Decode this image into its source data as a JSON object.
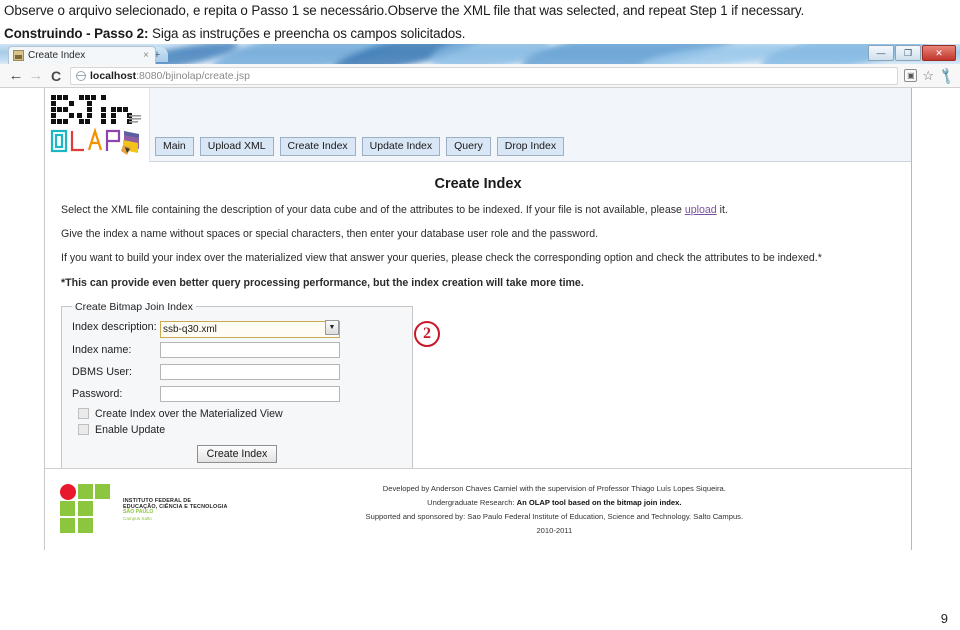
{
  "slide": {
    "caption_line1": "Observe o arquivo selecionado, e repita o Passo 1 se necessário.Observe the XML file that was selected, and repeat Step 1 if necessary.",
    "caption_line2_bold": "Construindo - Passo 2:",
    "caption_line2_rest": " Siga as instruções e preencha os campos solicitados.",
    "page_number": "9"
  },
  "browser": {
    "tab_title": "Create Index",
    "tab_close": "×",
    "new_tab": "+",
    "back_icon": "←",
    "forward_icon": "→",
    "reload_icon": "C",
    "url_host": "localhost",
    "url_rest": ":8080/bjinolap/create.jsp",
    "window_minimize": "—",
    "window_maximize": "❐",
    "window_close": "✕",
    "toolbar_icons": [
      "page-icon",
      "bookmark-star-icon",
      "wrench-menu-icon"
    ]
  },
  "site": {
    "logo_alt": "BJIn OLAP",
    "logo_word_top": "BJIn",
    "logo_word_bottom": "OLAP",
    "nav": [
      {
        "label": "Main"
      },
      {
        "label": "Upload XML"
      },
      {
        "label": "Create Index"
      },
      {
        "label": "Update Index"
      },
      {
        "label": "Query"
      },
      {
        "label": "Drop Index"
      }
    ],
    "page_title": "Create Index",
    "paragraphs": [
      {
        "text_before": "Select the XML file containing the description of your data cube and of the attributes to be indexed. If your file is not available, please ",
        "link": "upload",
        "text_after": " it.",
        "bold": false
      },
      {
        "text_before": "Give the index a name without spaces or special characters, then enter your database user role and the password.",
        "link": "",
        "text_after": "",
        "bold": false
      },
      {
        "text_before": "If you want to build your index over the materialized view that answer your queries, please check the corresponding option and check the attributes to be indexed.*",
        "link": "",
        "text_after": "",
        "bold": false
      },
      {
        "text_before": "*This can provide even better query processing performance, but the index creation will take more time.",
        "link": "",
        "text_after": "",
        "bold": true
      }
    ],
    "form": {
      "legend": "Create Bitmap Join Index",
      "index_description_label": "Index description:",
      "index_description_value": "ssb-q30.xml",
      "index_description_arrow": "▼",
      "index_name_label": "Index name:",
      "index_name_value": "",
      "dbms_user_label": "DBMS User:",
      "dbms_user_value": "",
      "password_label": "Password:",
      "password_value": "",
      "checkbox_materialized_view": "Create Index over the Materialized View",
      "checkbox_enable_update": "Enable Update",
      "submit_label": "Create Index"
    },
    "annotation_step": "2",
    "footer": {
      "line1": "Developed by Anderson Chaves Carniel with the supervision of Professor Thiago Luís Lopes Siqueira.",
      "line2_label": "Undergraduate Research: ",
      "line2_bold": "An OLAP tool based on the bitmap join index.",
      "line3": "Supported and sponsored by: Sao Paulo Federal Institute of Education, Science and Technology. Salto Campus.",
      "line4": "2010-2011",
      "ifsp_line1": "INSTITUTO FEDERAL DE",
      "ifsp_line2": "EDUCAÇÃO, CIÊNCIA E TECNOLOGIA",
      "ifsp_line3": "SÃO PAULO",
      "ifsp_line4": "Campus Salto"
    }
  },
  "colors": {
    "nav_button": "#d8e6f5",
    "annotation_red": "#c9182b",
    "link_purple": "#7a4f9e",
    "ifsp_green": "#8cc63f",
    "select_focus": "#c9a94f"
  }
}
